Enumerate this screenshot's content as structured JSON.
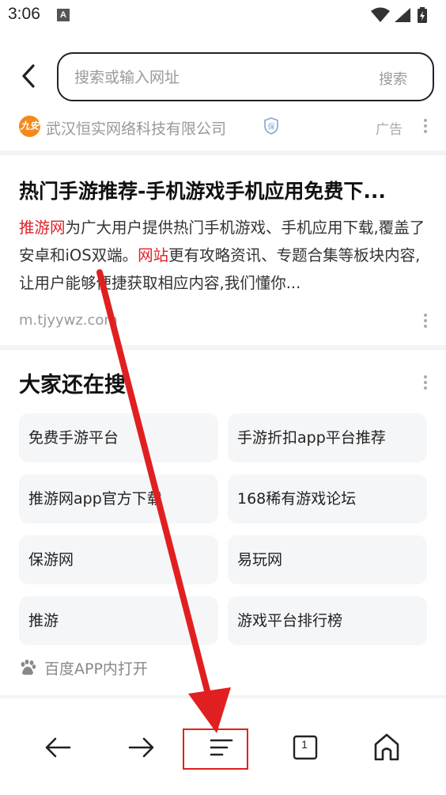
{
  "status_bar": {
    "time": "3:06",
    "notification_letter": "A",
    "icons": [
      "wifi-icon",
      "signal-icon",
      "battery-charging-icon"
    ]
  },
  "search": {
    "placeholder": "搜索或输入网址",
    "submit_label": "搜索",
    "back_icon": "chevron-left-icon"
  },
  "ad": {
    "logo_text": "九安",
    "company": "武汉恒实网络科技有限公司",
    "verify_icon": "shield-bao-icon",
    "ad_label": "广告",
    "more_icon": "vertical-dots-icon"
  },
  "result": {
    "title": "热门手游推荐-手机游戏手机应用免费下...",
    "snippet_kw1": "推游网",
    "snippet_p1": "为广大用户提供热门手机游戏、手机应用下载,覆盖了安卓和iOS双端。",
    "snippet_kw2": "网站",
    "snippet_p2": "更有攻略资讯、专题合集等板块内容,让用户能够便捷获取相应内容,我们懂你...",
    "url": "m.tjyywz.com"
  },
  "related": {
    "title": "大家还在搜",
    "items": [
      "免费手游平台",
      "手游折扣app平台推荐",
      "推游网app官方下载",
      "168稀有游戏论坛",
      "保游网",
      "易玩网",
      "推游",
      "游戏平台排行榜"
    ],
    "open_app_label": "百度APP内打开",
    "open_app_icon": "baidu-paw-icon"
  },
  "bottom_nav": {
    "items": [
      "back-arrow-icon",
      "forward-arrow-icon",
      "menu-icon",
      "tabs-icon",
      "home-icon"
    ],
    "tab_count": "1"
  },
  "annotation": {
    "color": "#e02020"
  }
}
